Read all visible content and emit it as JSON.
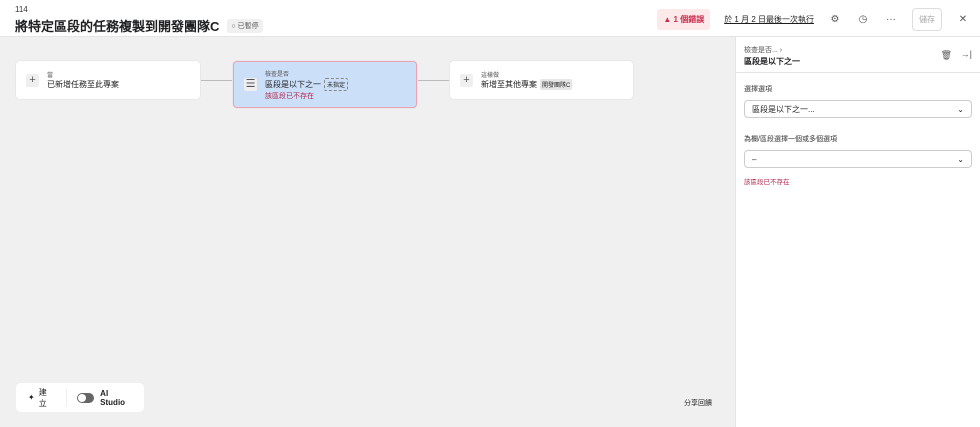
{
  "header": {
    "id": "114",
    "title": "將特定區段的任務複製到開發團隊C",
    "status": "已暫停",
    "error": "1 個錯誤",
    "last_run": "於 1 月 2 日最後一次執行",
    "save": "儲存"
  },
  "nodes": [
    {
      "caption": "當",
      "label": "已新增任務至此專案"
    },
    {
      "caption": "檢查是否",
      "label": "區段是以下之一",
      "tag": "未指定",
      "error": "該區段已不存在"
    },
    {
      "caption": "這樣做",
      "label": "新增至其他專案",
      "tag": "開發團隊C"
    }
  ],
  "bottom": {
    "create": "建立",
    "ai_studio": "AI Studio",
    "feedback": "分享回饋"
  },
  "panel": {
    "breadcrumb": "檢查是否... ›",
    "title": "區段是以下之一",
    "field1_label": "選擇選項",
    "field1_value": "區段是以下之一...",
    "field2_label": "為欄/區段選擇一個或多個選項",
    "field2_value": "–",
    "error": "該區段已不存在"
  }
}
